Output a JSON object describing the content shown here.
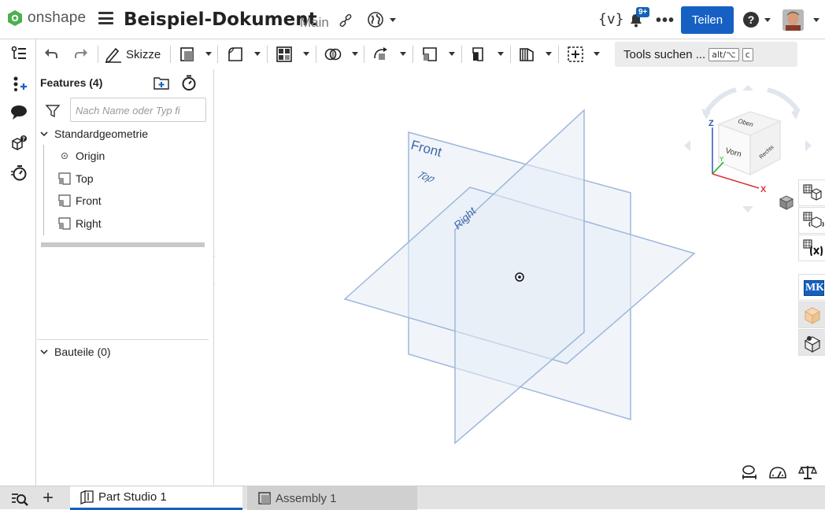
{
  "app": {
    "logo_text": "onshape"
  },
  "document": {
    "title": "Beispiel-Dokument",
    "branch": "Main"
  },
  "header": {
    "variables_icon": "{v}",
    "notification_badge": "9+",
    "more_label": "•••",
    "share_label": "Teilen",
    "help_label": "?"
  },
  "toolbar": {
    "sketch_label": "Skizze",
    "tools_search_label": "Tools suchen ...",
    "shortcut_key1": "alt/⌥",
    "shortcut_key2": "c"
  },
  "feature_panel": {
    "title": "Features (4)",
    "search_placeholder": "Nach Name oder Typ fi",
    "group_label": "Standardgeometrie",
    "items": [
      {
        "label": "Origin",
        "icon": "origin-icon"
      },
      {
        "label": "Top",
        "icon": "plane-icon"
      },
      {
        "label": "Front",
        "icon": "plane-icon"
      },
      {
        "label": "Right",
        "icon": "plane-icon"
      }
    ],
    "parts_label": "Bauteile (0)"
  },
  "viewport": {
    "plane_labels": {
      "front": "Front",
      "top": "Top",
      "right": "Right"
    },
    "view_cube": {
      "top": "Oben",
      "front": "Vorn",
      "right": "Rechts",
      "axis_z": "Z",
      "axis_y": "Y",
      "axis_x": "X"
    }
  },
  "right_panel": {
    "mk_label": "MK"
  },
  "tabs": [
    {
      "label": "Part Studio 1",
      "active": true
    },
    {
      "label": "Assembly 1",
      "active": false
    }
  ],
  "colors": {
    "accent": "#1660c4",
    "plane_fill": "#e6ecf5",
    "plane_stroke": "#9db7dc",
    "label_blue": "#3d67a8"
  }
}
